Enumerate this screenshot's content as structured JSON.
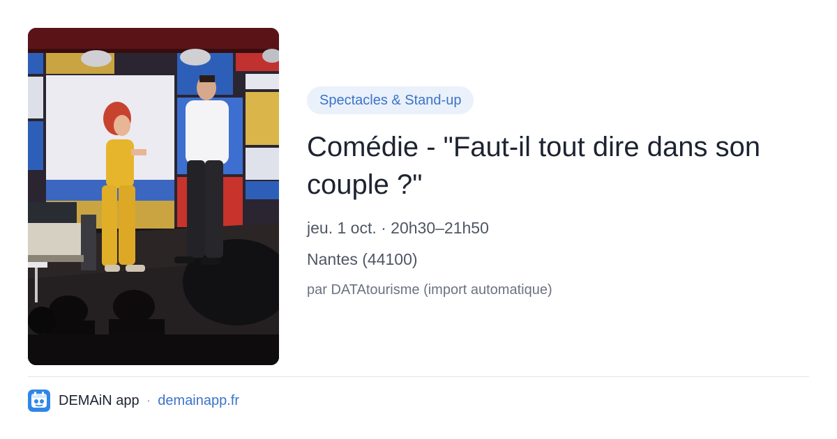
{
  "event": {
    "category": "Spectacles & Stand-up",
    "title": "Comédie - \"Faut-il tout dire dans son couple ?\"",
    "datetime": "jeu. 1 oct. · 20h30–21h50",
    "location": "Nantes (44100)",
    "source": "par DATAtourisme (import automatique)"
  },
  "footer": {
    "app_name": "DEMAiN app",
    "separator": "·",
    "domain": "demainapp.fr"
  },
  "colors": {
    "accent": "#3b73c9",
    "badge_bg": "#eaf1fb",
    "title": "#1c2331",
    "logo_bg": "#2f86e8"
  },
  "icons": {
    "app_logo": "demain-app-logo-icon"
  }
}
